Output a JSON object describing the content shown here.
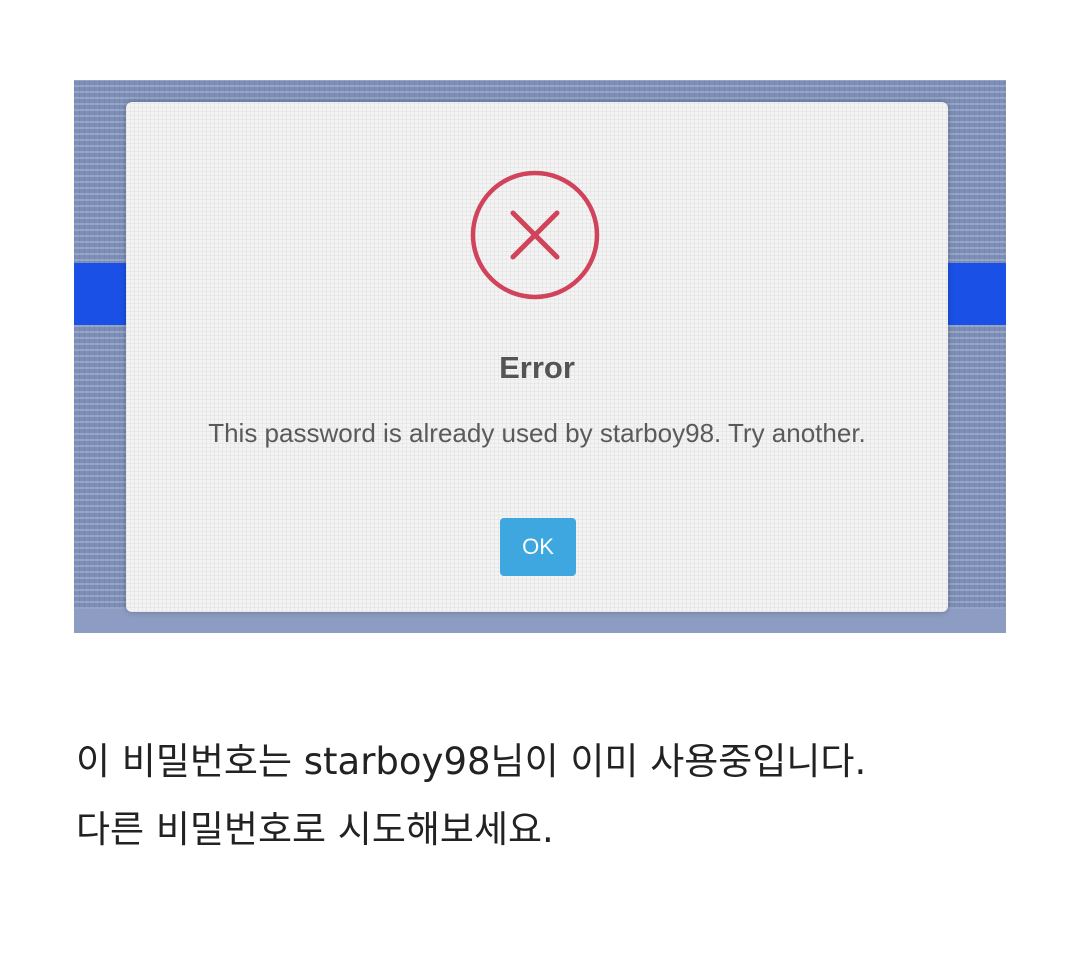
{
  "dialog": {
    "icon": "error-x-circle-icon",
    "title": "Error",
    "message": "This password is already used by starboy98. Try another.",
    "ok_label": "OK"
  },
  "caption": {
    "line1": "이 비밀번호는 starboy98님이 이미 사용중입니다.",
    "line2": "다른 비밀번호로 시도해보세요."
  },
  "colors": {
    "error_icon": "#d0435a",
    "ok_button": "#3fa7e0",
    "side_bars": "#1a50e6"
  }
}
